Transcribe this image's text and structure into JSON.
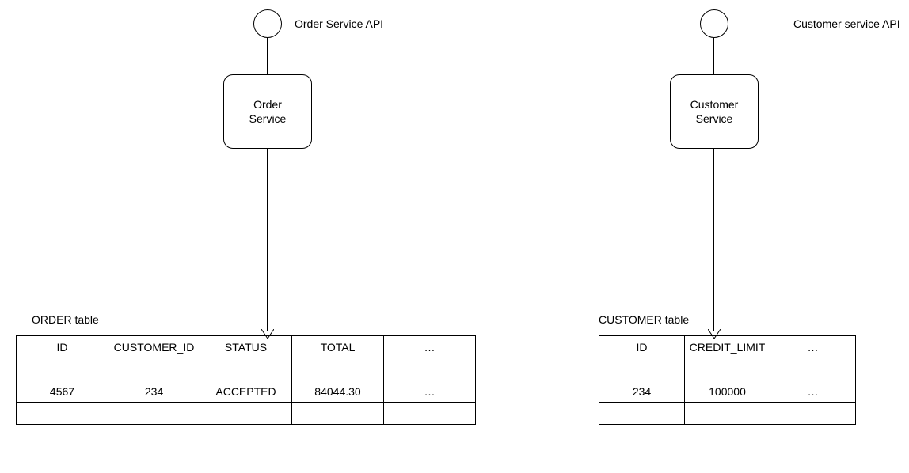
{
  "left": {
    "api_label": "Order Service API",
    "service_box": "Order\nService",
    "table_title": "ORDER table",
    "columns": [
      "ID",
      "CUSTOMER_ID",
      "STATUS",
      "TOTAL",
      "…"
    ],
    "rows": [
      [
        "",
        "",
        "",
        "",
        ""
      ],
      [
        "4567",
        "234",
        "ACCEPTED",
        "84044.30",
        "…"
      ],
      [
        "",
        "",
        "",
        "",
        ""
      ]
    ]
  },
  "right": {
    "api_label": "Customer service API",
    "service_box": "Customer\nService",
    "table_title": "CUSTOMER table",
    "columns": [
      "ID",
      "CREDIT_LIMIT",
      "…"
    ],
    "rows": [
      [
        "",
        "",
        ""
      ],
      [
        "234",
        "100000",
        "…"
      ],
      [
        "",
        "",
        ""
      ]
    ]
  }
}
